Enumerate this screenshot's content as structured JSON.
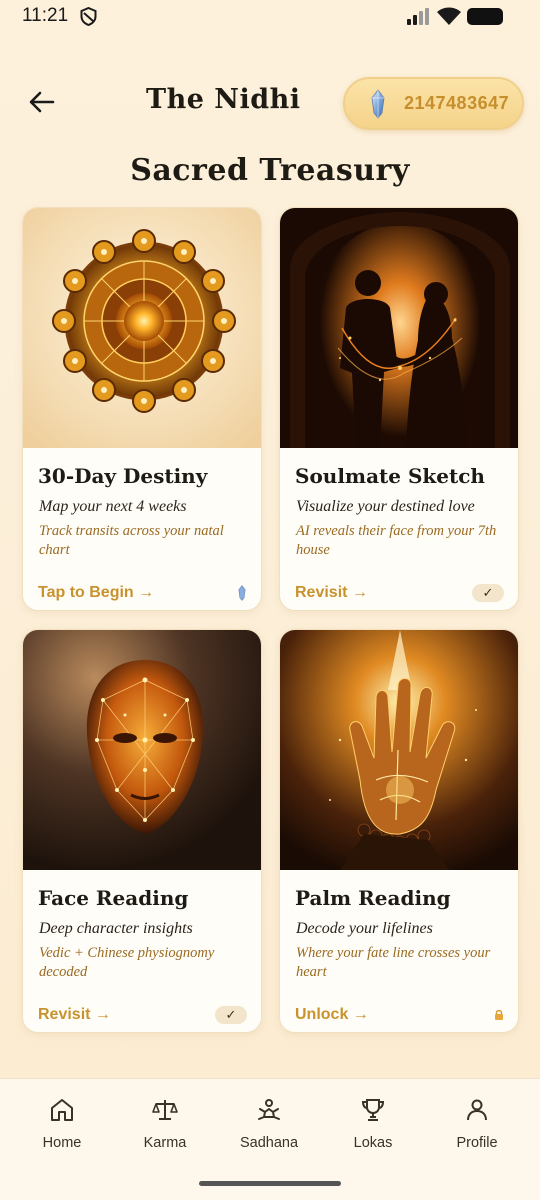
{
  "status": {
    "time": "11:21"
  },
  "header": {
    "title": "The Nidhi",
    "coins": "2147483647"
  },
  "section_title": "Sacred Treasury",
  "cards": [
    {
      "title": "30-Day Destiny",
      "subtitle": "Map your next 4 weeks",
      "description": "Track transits across your natal chart",
      "action": "Tap to Begin →",
      "badge": "crystal-icon"
    },
    {
      "title": "Soulmate Sketch",
      "subtitle": "Visualize your destined love",
      "description": "AI reveals their face from your 7th house",
      "action": "Revisit →",
      "badge": "check-icon"
    },
    {
      "title": "Face Reading",
      "subtitle": "Deep character insights",
      "description": "Vedic + Chinese physiognomy decoded",
      "action": "Revisit →",
      "badge": "check-icon"
    },
    {
      "title": "Palm Reading",
      "subtitle": "Decode your lifelines",
      "description": "Where your fate line crosses your heart",
      "action": "Unlock →",
      "badge": "lock-icon"
    }
  ],
  "nav": [
    {
      "label": "Home",
      "icon": "home-icon"
    },
    {
      "label": "Karma",
      "icon": "scales-icon"
    },
    {
      "label": "Sadhana",
      "icon": "meditation-icon"
    },
    {
      "label": "Lokas",
      "icon": "trophy-icon"
    },
    {
      "label": "Profile",
      "icon": "person-icon"
    }
  ],
  "colors": {
    "accent": "#c8922e",
    "background": "#fdf1dc",
    "pill": "#f5d38a"
  }
}
